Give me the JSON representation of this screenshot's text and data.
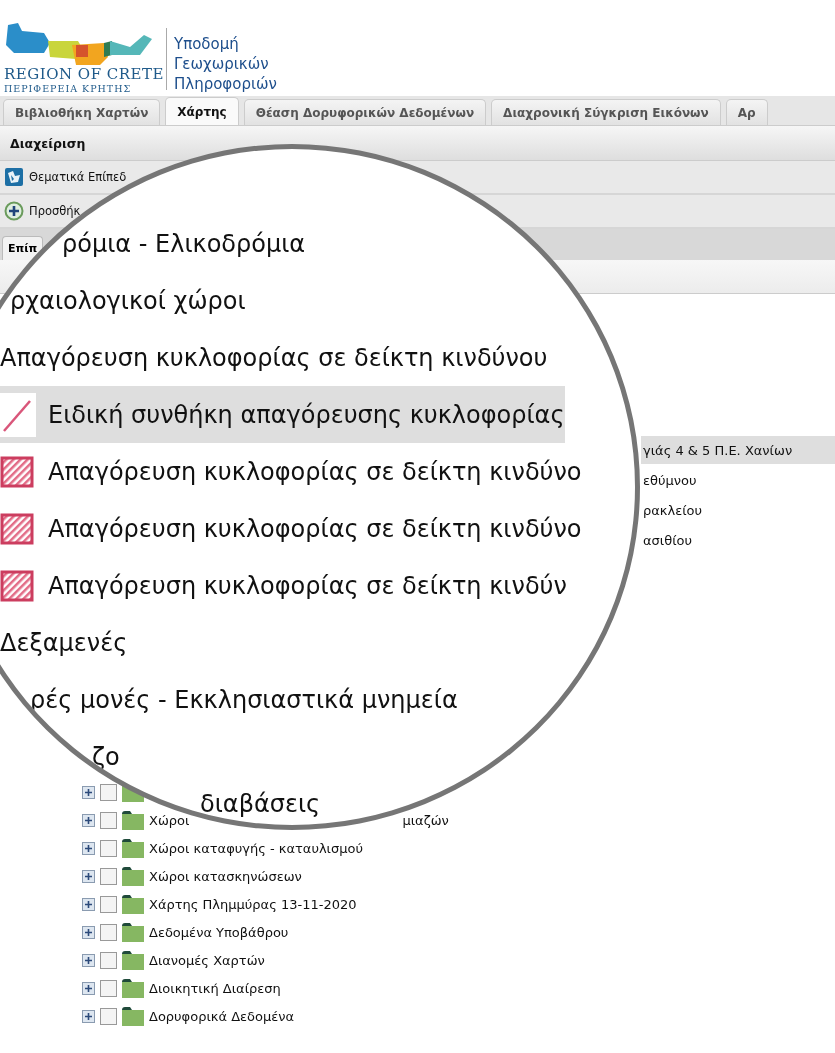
{
  "header": {
    "logo_title": "REGION OF CRETE",
    "logo_subtitle": "ΠΕΡΙΦΕΡΕΙΑ ΚΡΗΤΗΣ",
    "app_title": "Υποδομή Γεωχωρικών Πληροφοριών"
  },
  "tabs": [
    {
      "label": "Βιβλιοθήκη Χαρτών",
      "selected": false
    },
    {
      "label": "Χάρτης",
      "selected": true
    },
    {
      "label": "Θέαση Δορυφορικών Δεδομένων",
      "selected": false
    },
    {
      "label": "Διαχρονική Σύγκριση Εικόνων",
      "selected": false
    },
    {
      "label": "Αρ",
      "selected": false
    }
  ],
  "panel": {
    "title": "Διαχείριση",
    "items": [
      {
        "label": "Θεματικά Επίπεδ",
        "kind": "layers"
      },
      {
        "label": "Προσθήκ",
        "kind": "add"
      }
    ],
    "subtab": "Επίπ"
  },
  "layer_rows": [
    {
      "label": "γιάς 4 & 5 Π.Ε. Χανίων",
      "selected": true
    },
    {
      "label": "εθύμνου",
      "selected": false
    },
    {
      "label": "ρακλείου",
      "selected": false
    },
    {
      "label": "ασιθίου",
      "selected": false
    }
  ],
  "tree": [
    {
      "expanded": false,
      "checked": false
    },
    {
      "label": "Χώροι",
      "label_tail": "μιαζών",
      "expanded": false,
      "checked": false
    },
    {
      "label": "Χώροι καταφυγής - καταυλισμού",
      "expanded": false,
      "checked": false
    },
    {
      "label": "Χώροι κατασκηνώσεων",
      "expanded": false,
      "checked": false
    },
    {
      "label": "Χάρτης Πλημμύρας 13-11-2020",
      "expanded": false,
      "checked": false
    },
    {
      "label": "Δεδομένα Υποβάθρου",
      "expanded": false,
      "checked": false
    },
    {
      "label": "Διανομές Χαρτών",
      "expanded": false,
      "checked": false
    },
    {
      "label": "Διοικητική Διαίρεση",
      "expanded": false,
      "checked": false
    },
    {
      "label": "Δορυφορικά Δεδομένα",
      "expanded": false,
      "checked": false
    }
  ],
  "magnifier": {
    "rows": [
      {
        "label": "ρόμια - Ελικοδρόμια",
        "kind": "group",
        "selected": false
      },
      {
        "label": "ρχαιολογικοί χώροι",
        "kind": "group",
        "selected": false
      },
      {
        "label": "Απαγόρευση κυκλοφορίας σε δείκτη κινδύνου",
        "kind": "group",
        "selected": false
      },
      {
        "label": "Ειδική συνθήκη απαγόρευσης κυκλοφορίας",
        "kind": "line-symbol",
        "selected": true
      },
      {
        "label": "Απαγόρευση κυκλοφορίας σε δείκτη κινδύνο",
        "kind": "hatch-symbol",
        "selected": false
      },
      {
        "label": "Απαγόρευση κυκλοφορίας σε δείκτη κινδύνο",
        "kind": "hatch-symbol",
        "selected": false
      },
      {
        "label": "Απαγόρευση κυκλοφορίας σε δείκτη κινδύν",
        "kind": "hatch-symbol",
        "selected": false
      },
      {
        "label": "Δεξαμενές",
        "kind": "group",
        "selected": false
      },
      {
        "label": "ρές μονές - Εκκλησιαστικά μνημεία",
        "kind": "group",
        "selected": false
      },
      {
        "label": "ζο",
        "kind": "group",
        "selected": false
      },
      {
        "label": "διαβάσεις",
        "kind": "group",
        "selected": false
      }
    ]
  }
}
